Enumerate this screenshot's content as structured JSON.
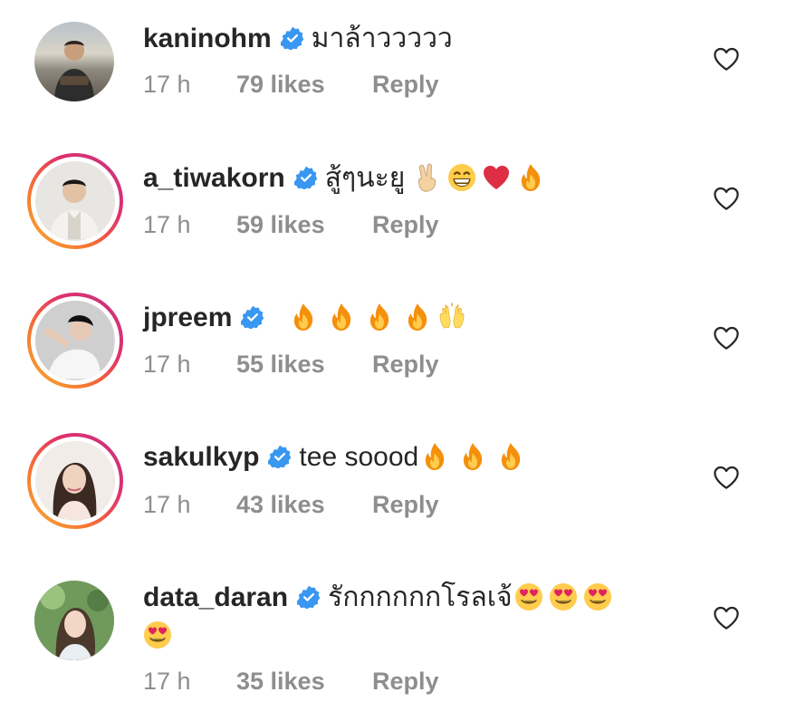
{
  "reply_label": "Reply",
  "colors": {
    "verified": "#3897f0",
    "muted": "#8e8e8e",
    "text": "#262626"
  },
  "comments": [
    {
      "username": "kaninohm",
      "text": "มาล้าววววว",
      "emojis": [],
      "time": "17 h",
      "likes": "79 likes",
      "story_ring": false,
      "avatar_icon": "avatar-man-beach"
    },
    {
      "username": "a_tiwakorn",
      "text": "สู้ๆนะยู",
      "emojis": [
        "victory-hand",
        "grinning-face",
        "red-heart",
        "fire"
      ],
      "time": "17 h",
      "likes": "59 likes",
      "story_ring": true,
      "avatar_icon": "avatar-man-suit"
    },
    {
      "username": "jpreem",
      "text": "",
      "emojis": [
        "fire",
        "fire",
        "fire",
        "fire",
        "raising-hands"
      ],
      "time": "17 h",
      "likes": "55 likes",
      "story_ring": true,
      "avatar_icon": "avatar-woman-pose"
    },
    {
      "username": "sakulkyp",
      "text": "tee soood",
      "emojis": [
        "fire",
        "fire",
        "fire"
      ],
      "time": "17 h",
      "likes": "43 likes",
      "story_ring": true,
      "avatar_icon": "avatar-woman-portrait"
    },
    {
      "username": "data_daran",
      "text": "รักกกกกกโรลเจ้",
      "emojis": [
        "heart-eyes",
        "heart-eyes",
        "heart-eyes"
      ],
      "emojis_line2": [
        "heart-eyes"
      ],
      "time": "17 h",
      "likes": "35 likes",
      "story_ring": false,
      "avatar_icon": "avatar-woman-garden"
    }
  ]
}
